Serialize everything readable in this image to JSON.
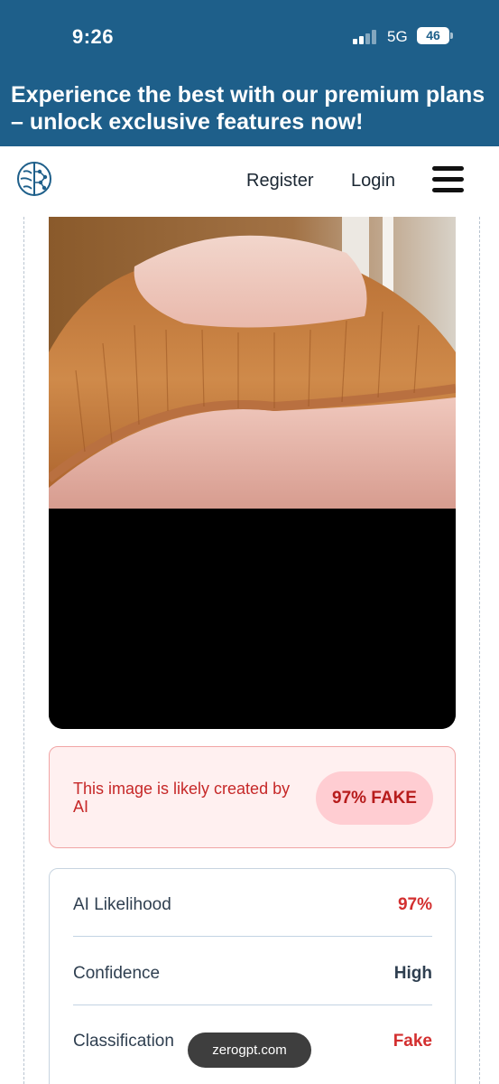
{
  "status_bar": {
    "time": "9:26",
    "network": "5G",
    "battery": "46"
  },
  "promo": {
    "text": "Experience the best with our premium plans – unlock exclusive features now!"
  },
  "nav": {
    "register": "Register",
    "login": "Login",
    "logo_icon": "brain-icon",
    "menu_icon": "hamburger-menu-icon"
  },
  "result": {
    "message": "This image is likely created by AI",
    "badge": "97% FAKE"
  },
  "stats": [
    {
      "label": "AI Likelihood",
      "value": "97%",
      "color": "#d32f2f"
    },
    {
      "label": "Confidence",
      "value": "High",
      "color": "#2f3f50"
    },
    {
      "label": "Classification",
      "value": "Fake",
      "color": "#d32f2f"
    }
  ],
  "browser": {
    "url": "zerogpt.com"
  },
  "colors": {
    "brand_blue": "#1e5f8a",
    "fake_red": "#d32f2f"
  }
}
